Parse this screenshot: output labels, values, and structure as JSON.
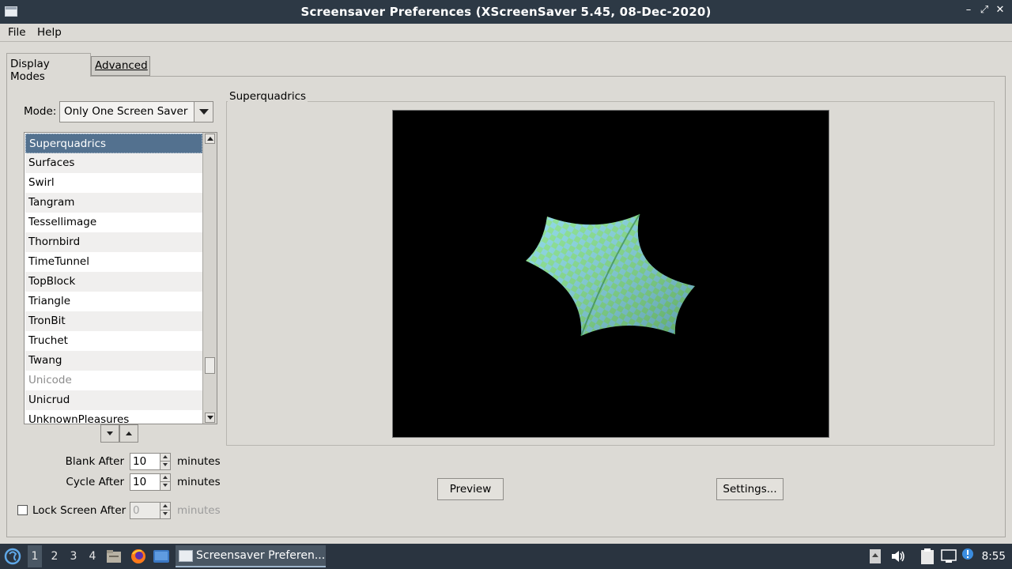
{
  "window": {
    "title": "Screensaver Preferences  (XScreenSaver 5.45, 08-Dec-2020)",
    "controls": [
      "–",
      "⤢",
      "✕"
    ]
  },
  "menubar": {
    "file": "File",
    "help": "Help"
  },
  "tabs": [
    {
      "label": "Display Modes",
      "active": true
    },
    {
      "label": "Advanced",
      "active": false
    }
  ],
  "mode": {
    "label": "Mode:",
    "value": "Only One Screen Saver"
  },
  "savers": [
    {
      "name": "Superquadrics",
      "selected": true,
      "disabled": false
    },
    {
      "name": "Surfaces",
      "selected": false,
      "disabled": false
    },
    {
      "name": "Swirl",
      "selected": false,
      "disabled": false
    },
    {
      "name": "Tangram",
      "selected": false,
      "disabled": false
    },
    {
      "name": "Tessellimage",
      "selected": false,
      "disabled": false
    },
    {
      "name": "Thornbird",
      "selected": false,
      "disabled": false
    },
    {
      "name": "TimeTunnel",
      "selected": false,
      "disabled": false
    },
    {
      "name": "TopBlock",
      "selected": false,
      "disabled": false
    },
    {
      "name": "Triangle",
      "selected": false,
      "disabled": false
    },
    {
      "name": "TronBit",
      "selected": false,
      "disabled": false
    },
    {
      "name": "Truchet",
      "selected": false,
      "disabled": false
    },
    {
      "name": "Twang",
      "selected": false,
      "disabled": false
    },
    {
      "name": "Unicode",
      "selected": false,
      "disabled": true
    },
    {
      "name": "Unicrud",
      "selected": false,
      "disabled": false
    },
    {
      "name": "UnknownPleasures",
      "selected": false,
      "disabled": false
    }
  ],
  "list_scroll_position": 0.85,
  "timing": {
    "blank_label": "Blank After",
    "blank_value": "10",
    "cycle_label": "Cycle After",
    "cycle_value": "10",
    "lock_label": "Lock Screen After",
    "lock_value": "0",
    "lock_checked": false,
    "unit": "minutes"
  },
  "preview": {
    "frame_title": "Superquadrics",
    "preview_button": "Preview",
    "settings_button": "Settings..."
  },
  "taskbar": {
    "workspaces": [
      "1",
      "2",
      "3",
      "4"
    ],
    "active_workspace": "1",
    "app_title": "Screensaver Preferen...",
    "clock": "8:55",
    "icons": [
      "start-menu-icon",
      "file-manager-icon",
      "firefox-icon",
      "show-desktop-icon",
      "usb-icon",
      "volume-icon",
      "clipboard-icon",
      "network-icon",
      "notification-icon"
    ]
  },
  "colors": {
    "titlebar": "#2d3945",
    "selection": "#53718f",
    "window_bg": "#dcdad5",
    "taskbar": "#2a3440"
  }
}
